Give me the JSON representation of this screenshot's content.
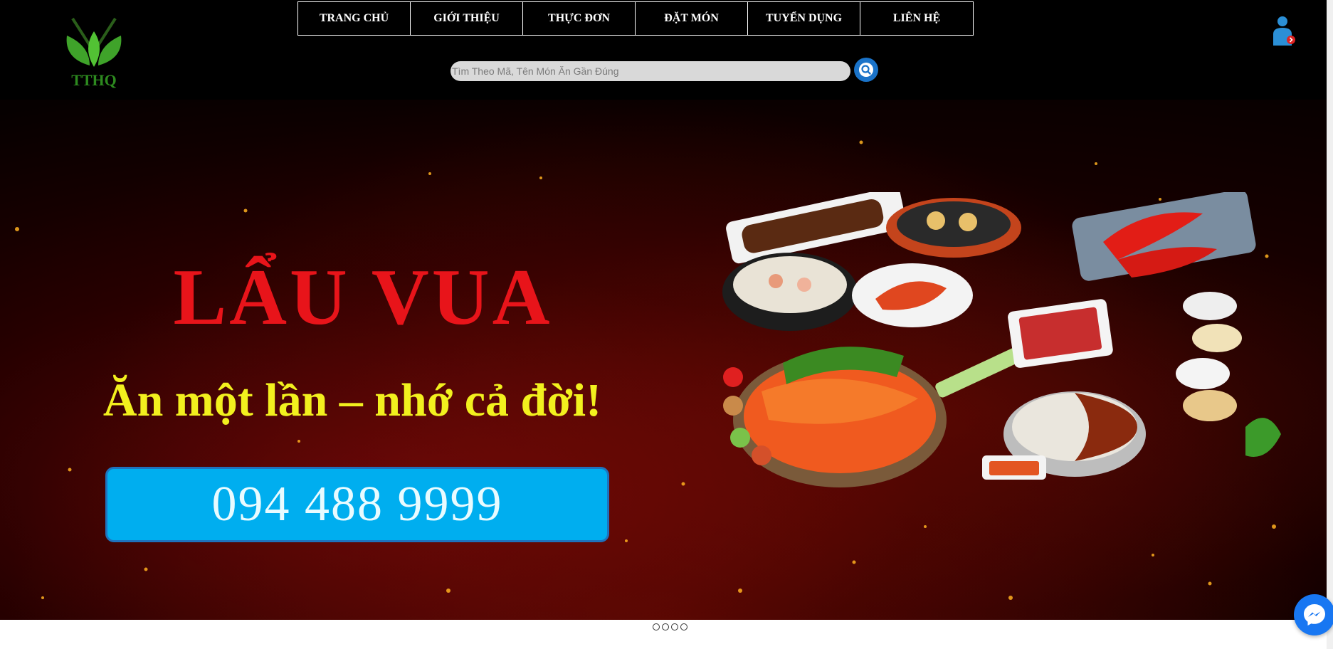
{
  "nav": {
    "items": [
      {
        "label": "TRANG CHỦ"
      },
      {
        "label": "GIỚI THIỆU"
      },
      {
        "label": "THỰC ĐƠN"
      },
      {
        "label": "ĐẶT MÓN"
      },
      {
        "label": "TUYỂN DỤNG"
      },
      {
        "label": "LIÊN HỆ"
      }
    ]
  },
  "logo": {
    "text": "TTHQ",
    "icon": "leaf-fork-knife-logo"
  },
  "search": {
    "placeholder": "Tìm Theo Mã, Tên Món Ăn Gần Đúng",
    "value": "",
    "icon": "search-icon"
  },
  "user": {
    "icon": "user-icon"
  },
  "hero": {
    "title": "LẨU VUA",
    "tagline": "Ăn một lần – nhớ cả đời!",
    "phone": "094 488 9999"
  },
  "slider": {
    "dot_count": 4
  },
  "messenger": {
    "icon": "messenger-icon"
  },
  "colors": {
    "header_bg": "#000000",
    "title_red": "#e8141a",
    "tagline_yellow": "#f2f01e",
    "phone_blue": "#00aeef",
    "search_btn": "#1a73c9",
    "messenger": "#1877f2"
  }
}
